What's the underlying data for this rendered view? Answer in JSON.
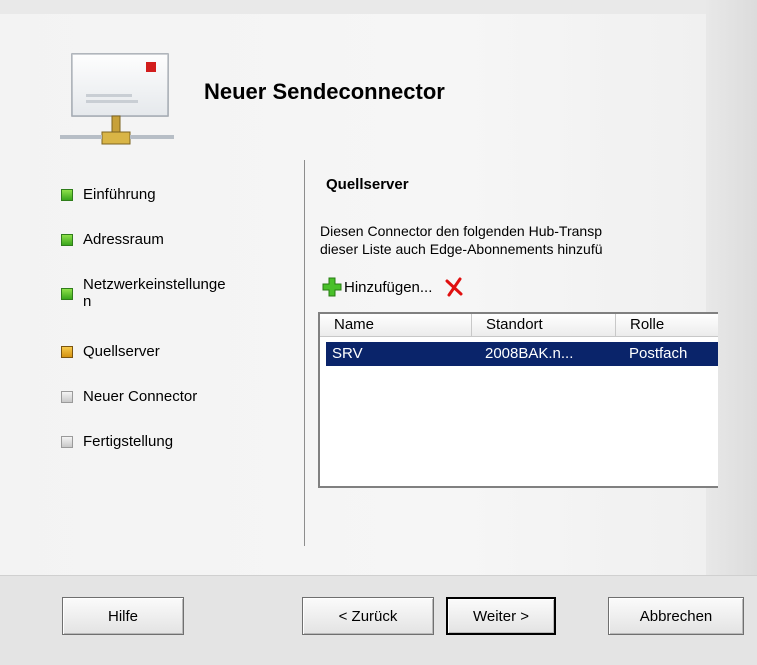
{
  "window": {
    "title": "Neuer Sendeconnector"
  },
  "nav": {
    "items": [
      {
        "label": "Einführung",
        "state": "done"
      },
      {
        "label": "Adressraum",
        "state": "done"
      },
      {
        "label": "Netzwerkeinstellunge\nn",
        "state": "done"
      },
      {
        "label": "Quellserver",
        "state": "current"
      },
      {
        "label": "Neuer Connector",
        "state": "pending"
      },
      {
        "label": "Fertigstellung",
        "state": "pending"
      }
    ]
  },
  "content": {
    "section_title": "Quellserver",
    "description_line1": "Diesen Connector den folgenden Hub-Transp",
    "description_line2": "dieser Liste auch Edge-Abonnements hinzufü",
    "toolbar": {
      "add_label": "Hinzufügen...",
      "add_icon": "green-plus-icon",
      "delete_icon": "red-x-icon"
    },
    "table": {
      "columns": [
        "Name",
        "Standort",
        "Rolle"
      ],
      "rows": [
        {
          "name": "SRV",
          "standort": "2008BAK.n...",
          "rolle": "Postfach",
          "selected": true
        }
      ]
    }
  },
  "buttons": {
    "help": "Hilfe",
    "back": "< Zurück",
    "next": "Weiter >",
    "cancel": "Abbrechen"
  },
  "colors": {
    "selection": "#0a246a",
    "done": "#3aa61c",
    "current": "#d49312",
    "pending": "#c8c8c8"
  }
}
